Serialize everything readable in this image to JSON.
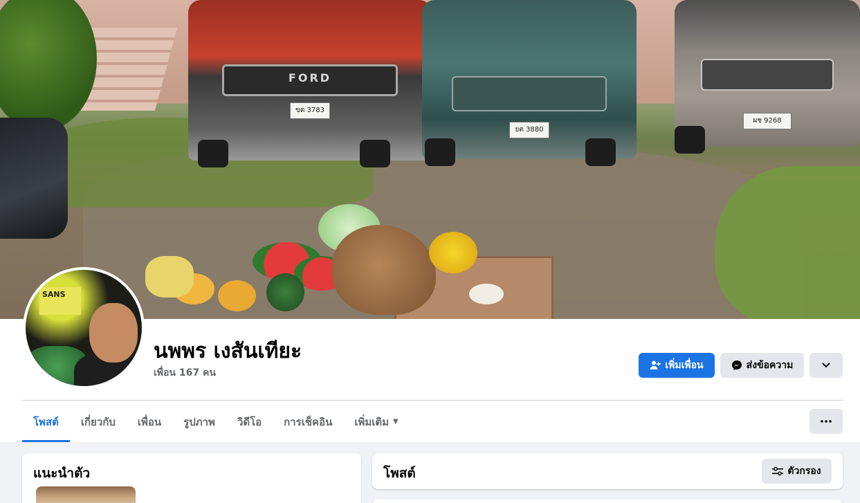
{
  "cover": {
    "plates": {
      "red_truck": "ขต 3783",
      "teal_truck": "ยต 3880",
      "grey_truck": "ผช 9268"
    },
    "brand_text": "FORD",
    "avatar_sign": "SANS"
  },
  "profile": {
    "name": "นพพร เงสันเทียะ",
    "friends": "เพื่อน 167 คน"
  },
  "actions": {
    "add_friend": "เพิ่มเพื่อน",
    "message": "ส่งข้อความ"
  },
  "tabs": [
    {
      "label": "โพสต์",
      "active": true
    },
    {
      "label": "เกี่ยวกับ",
      "active": false
    },
    {
      "label": "เพื่อน",
      "active": false
    },
    {
      "label": "รูปภาพ",
      "active": false
    },
    {
      "label": "วิดีโอ",
      "active": false
    },
    {
      "label": "การเช็คอิน",
      "active": false
    },
    {
      "label": "เพิ่มเติม",
      "active": false
    }
  ],
  "intro": {
    "title": "แนะนำตัว"
  },
  "posts": {
    "title": "โพสต์",
    "filter": "ตัวกรอง"
  },
  "colors": {
    "accent": "#1b74e4",
    "secondary_button": "#e4e6eb",
    "muted_text": "#65676b",
    "page_bg": "#f0f2f5"
  },
  "icons": {
    "add_friend": "person-plus-icon",
    "message": "messenger-icon",
    "chevron": "chevron-down-icon",
    "more": "ellipsis-icon",
    "filter": "sliders-icon",
    "tab_dropdown": "caret-down-icon"
  }
}
